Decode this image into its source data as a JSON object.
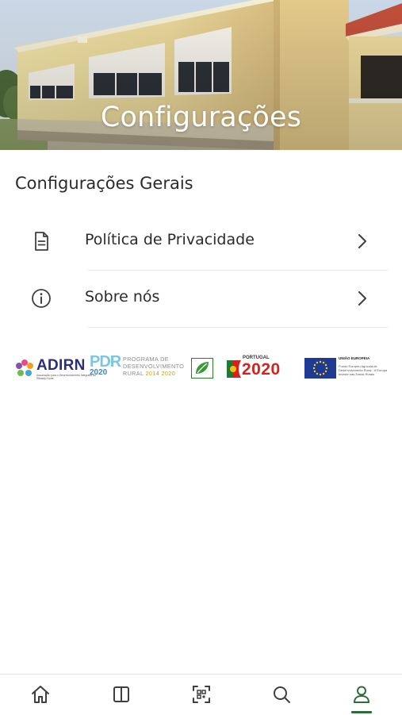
{
  "hero": {
    "title": "Configurações"
  },
  "section": {
    "title": "Configurações Gerais",
    "items": [
      {
        "label": "Política de Privacidade",
        "icon": "document-icon"
      },
      {
        "label": "Sobre nós",
        "icon": "info-icon"
      }
    ]
  },
  "logos": {
    "adirn": {
      "name": "ADIRN",
      "subtitle": "Associação para o Desenvolvimento Integrado do Ribatejo Norte"
    },
    "pdr": {
      "mark": "PDR",
      "mark_year": "2020",
      "line1": "PROGRAMA DE",
      "line2": "DESENVOLVIMENTO",
      "line3": "RURAL",
      "years": "2014 2020"
    },
    "leader": {
      "name": "LEADER"
    },
    "portugal2020": {
      "small": "PORTUGAL",
      "big": "2020"
    },
    "eu": {
      "head": "UNIÃO EUROPEIA",
      "text": "Fundo Europeu Agrícola de Desenvolvimento Rural · A Europa investe nas Zonas Rurais"
    }
  },
  "bottom_nav": {
    "items": [
      {
        "name": "home",
        "icon": "home-icon"
      },
      {
        "name": "book",
        "icon": "book-icon"
      },
      {
        "name": "qr-scan",
        "icon": "qr-scan-icon"
      },
      {
        "name": "search",
        "icon": "search-icon"
      },
      {
        "name": "profile",
        "icon": "user-icon",
        "active": true
      }
    ]
  },
  "colors": {
    "accent": "#2e6b3a",
    "icon": "#3f3f3f",
    "divider": "#e9e9e9"
  }
}
